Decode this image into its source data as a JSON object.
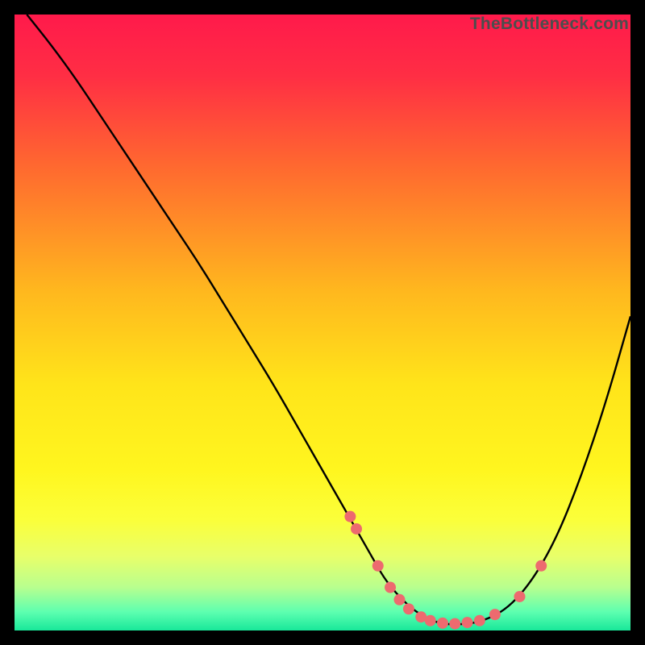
{
  "watermark": "TheBottleneck.com",
  "chart_data": {
    "type": "line",
    "title": "",
    "xlabel": "",
    "ylabel": "",
    "xlim": [
      0,
      100
    ],
    "ylim": [
      0,
      100
    ],
    "background_gradient": {
      "stops": [
        {
          "offset": 0.0,
          "color": "#ff1a4b"
        },
        {
          "offset": 0.1,
          "color": "#ff2e44"
        },
        {
          "offset": 0.25,
          "color": "#ff6a2f"
        },
        {
          "offset": 0.45,
          "color": "#ffb81e"
        },
        {
          "offset": 0.6,
          "color": "#ffe41a"
        },
        {
          "offset": 0.74,
          "color": "#fff61f"
        },
        {
          "offset": 0.82,
          "color": "#fbff3a"
        },
        {
          "offset": 0.88,
          "color": "#e8ff6a"
        },
        {
          "offset": 0.93,
          "color": "#b8ff8f"
        },
        {
          "offset": 0.97,
          "color": "#5dffb0"
        },
        {
          "offset": 1.0,
          "color": "#18e89a"
        }
      ]
    },
    "series": [
      {
        "name": "bottleneck-curve",
        "color": "#000000",
        "x": [
          2,
          6,
          10,
          14,
          18,
          22,
          26,
          30,
          34,
          38,
          42,
          46,
          50,
          54,
          58,
          60,
          62,
          64,
          66,
          68,
          70,
          73,
          76,
          80,
          84,
          88,
          92,
          96,
          100
        ],
        "y": [
          100,
          95,
          89.5,
          83.5,
          77.5,
          71.5,
          65.5,
          59.5,
          53,
          46.5,
          40,
          33,
          26,
          19,
          12,
          8.5,
          6,
          4,
          2.5,
          1.5,
          1,
          1,
          1.5,
          3.5,
          8,
          15,
          25,
          37,
          51
        ]
      }
    ],
    "markers": {
      "name": "optimal-points",
      "color": "#ed6a6f",
      "radius": 7,
      "points": [
        {
          "x": 54.5,
          "y": 18.5
        },
        {
          "x": 55.5,
          "y": 16.5
        },
        {
          "x": 59.0,
          "y": 10.5
        },
        {
          "x": 61.0,
          "y": 7.0
        },
        {
          "x": 62.5,
          "y": 5.0
        },
        {
          "x": 64.0,
          "y": 3.5
        },
        {
          "x": 66.0,
          "y": 2.2
        },
        {
          "x": 67.5,
          "y": 1.6
        },
        {
          "x": 69.5,
          "y": 1.2
        },
        {
          "x": 71.5,
          "y": 1.1
        },
        {
          "x": 73.5,
          "y": 1.3
        },
        {
          "x": 75.5,
          "y": 1.6
        },
        {
          "x": 78.0,
          "y": 2.6
        },
        {
          "x": 82.0,
          "y": 5.5
        },
        {
          "x": 85.5,
          "y": 10.5
        }
      ]
    }
  }
}
